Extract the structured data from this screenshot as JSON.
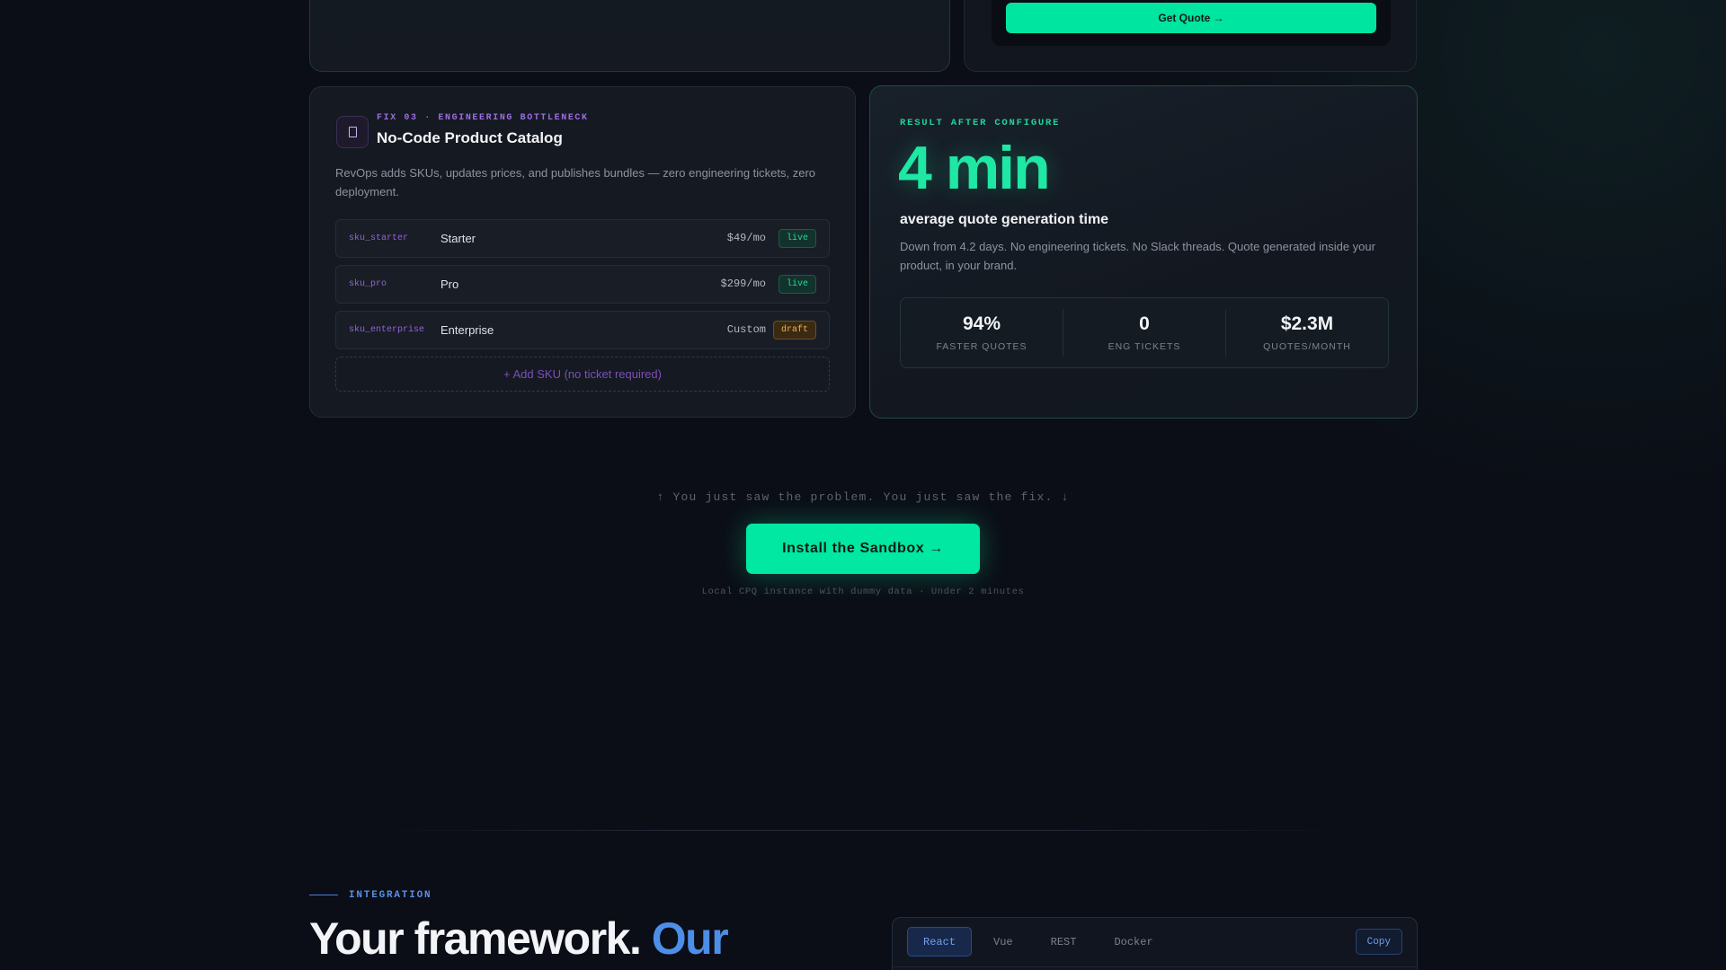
{
  "quote_card": {
    "get_quote_label": "Get Quote →"
  },
  "catalog": {
    "tag": "FIX 03 · ENGINEERING BOTTLENECK",
    "title": "No-Code Product Catalog",
    "description": "RevOps adds SKUs, updates prices, and publishes bundles — zero engineering tickets, zero deployment.",
    "icon": "box-icon",
    "skus": [
      {
        "code": "sku_starter",
        "name": "Starter",
        "price": "$49/mo",
        "status": "live"
      },
      {
        "code": "sku_pro",
        "name": "Pro",
        "price": "$299/mo",
        "status": "live"
      },
      {
        "code": "sku_enterprise",
        "name": "Enterprise",
        "price": "Custom",
        "status": "draft"
      }
    ],
    "add_sku_label": "+ Add SKU (no ticket required)"
  },
  "result": {
    "tag": "RESULT AFTER CONFIGURE",
    "big_value": "4 min",
    "subtitle": "average quote generation time",
    "description": "Down from 4.2 days. No engineering tickets. No Slack threads. Quote generated inside your product, in your brand.",
    "stats": [
      {
        "value": "94%",
        "label": "FASTER QUOTES"
      },
      {
        "value": "0",
        "label": "ENG TICKETS"
      },
      {
        "value": "$2.3M",
        "label": "QUOTES/MONTH"
      }
    ]
  },
  "cta": {
    "note": "↑ You just saw the problem. You just saw the fix. ↓",
    "button_label": "Install the Sandbox →",
    "footnote": "Local CPQ instance with dummy data · Under 2 minutes"
  },
  "integration": {
    "tag": "INTEGRATION",
    "title_plain": "Your framework.",
    "title_accent": "Our",
    "tabs": [
      "React",
      "Vue",
      "REST",
      "Docker"
    ],
    "active_tab": "React",
    "copy_label": "Copy"
  },
  "colors": {
    "accent_green": "#00e5a0",
    "accent_purple": "#9b6ee0",
    "accent_blue": "#4d8ee8",
    "background": "#0b0e16"
  }
}
